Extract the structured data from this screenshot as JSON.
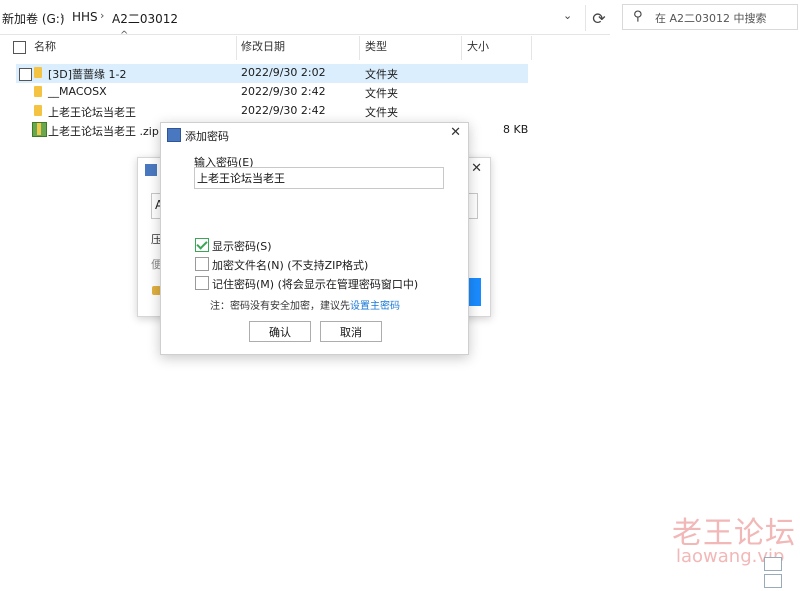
{
  "address_bar": {
    "crumbs": [
      "新加卷 (G:)",
      "HHS",
      "A2二03012"
    ],
    "search_placeholder": "在 A2二03012 中搜索"
  },
  "columns": {
    "name": "名称",
    "modified": "修改日期",
    "type": "类型",
    "size": "大小"
  },
  "files": [
    {
      "name": "[3D]蔷蔷缘 1-2",
      "modified": "2022/9/30 2:02",
      "type": "文件夹",
      "size": "",
      "icon": "folder-icon",
      "selected": true
    },
    {
      "name": "__MACOSX",
      "modified": "2022/9/30 2:42",
      "type": "文件夹",
      "size": "",
      "icon": "folder-icon",
      "selected": false
    },
    {
      "name": "上老王论坛当老王",
      "modified": "2022/9/30 2:42",
      "type": "文件夹",
      "size": "",
      "icon": "folder-icon",
      "selected": false
    },
    {
      "name": "上老王论坛当老王 .zip",
      "modified": "",
      "type": "",
      "size": "8 KB",
      "icon": "zip-archive-icon",
      "selected": false
    }
  ],
  "background_window": {
    "field_text": "A",
    "label_1": "压",
    "label_2": "便"
  },
  "dialog": {
    "title": "添加密码",
    "password_label": "输入密码(E)",
    "password_value": "上老王论坛当老王",
    "options": [
      {
        "label": "显示密码(S)",
        "checked": true
      },
      {
        "label": "加密文件名(N) (不支持ZIP格式)",
        "checked": false
      },
      {
        "label": "记住密码(M) (将会显示在管理密码窗口中)",
        "checked": false
      }
    ],
    "note_prefix": "注：密码没有安全加密，建议先",
    "note_link": "设置主密码",
    "ok_label": "确认",
    "cancel_label": "取消"
  },
  "watermark": {
    "title": "老王论坛",
    "url": "laowang.vip"
  },
  "colors": {
    "selection": "#dbeefd",
    "link": "#1a78d6",
    "folder": "#f5c342",
    "check": "#3aa757",
    "watermark": "#f2b7b7"
  }
}
